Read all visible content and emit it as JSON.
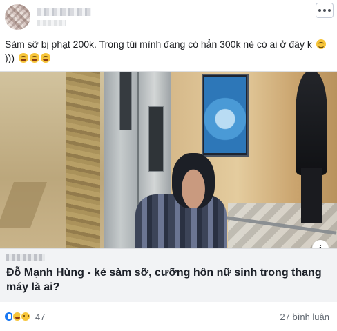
{
  "post": {
    "caption": "Sàm sỡ bị phạt 200k. Trong túi mình đang có hẳn 300k nè có ai ở đây k",
    "caption_tail": ")))",
    "more_icon": "ellipsis-icon"
  },
  "link": {
    "title": "Đỗ Mạnh Hùng - kẻ sàm sỡ, cưỡng hôn nữ sinh trong thang máy là ai?",
    "info_icon": "info-icon",
    "info_glyph": "i"
  },
  "footer": {
    "reaction_count": "47",
    "comment_count": "27 bình luận",
    "reactions": [
      "like",
      "haha",
      "sad"
    ]
  },
  "colors": {
    "like_blue": "#1877f2",
    "emoji_yellow": "#f7c53a",
    "meta_gray": "#606770"
  }
}
